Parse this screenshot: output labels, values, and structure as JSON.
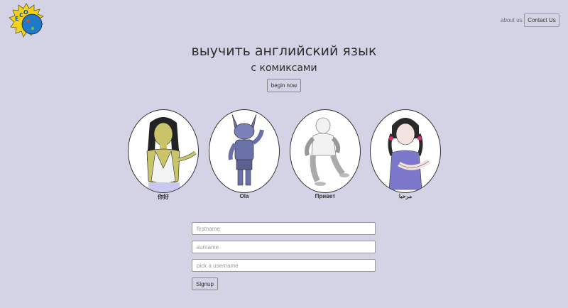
{
  "nav": {
    "about_label": "about us",
    "contact_label": "Contact Us"
  },
  "hero": {
    "title": "выучить английский язык",
    "subtitle": "с комиксами",
    "begin_label": "begin now"
  },
  "characters": [
    {
      "name": "你好",
      "icon": "girl-character-icon"
    },
    {
      "name": "Ola",
      "icon": "fox-character-icon"
    },
    {
      "name": "Привет",
      "icon": "boy-character-icon"
    },
    {
      "name": "مرحبا",
      "icon": "pigtail-girl-character-icon"
    }
  ],
  "form": {
    "firstname_placeholder": "firstname",
    "surname_placeholder": "surname",
    "username_placeholder": "pick a username",
    "signup_label": "Signup"
  },
  "colors": {
    "background": "#d3d3e5",
    "logo_blue": "#1f78c8",
    "logo_yellow": "#f2d21b"
  }
}
